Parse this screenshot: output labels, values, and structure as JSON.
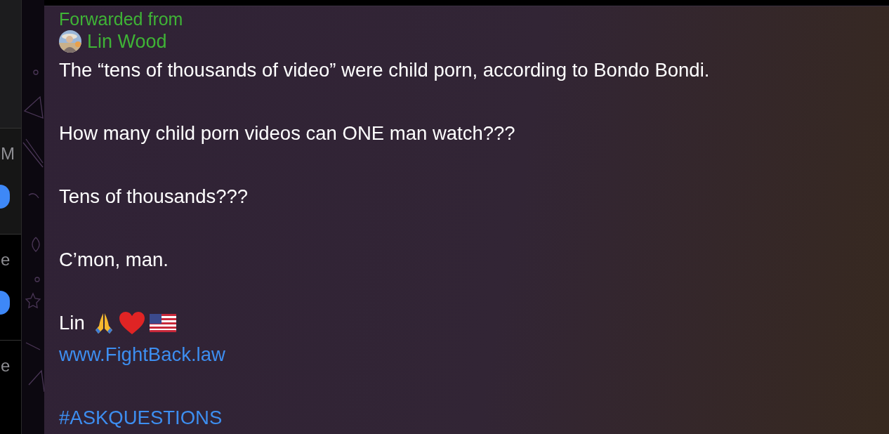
{
  "sidebar": {
    "items": [
      {
        "text": "M",
        "unread": true,
        "selected": true
      },
      {
        "text": "e",
        "unread": true,
        "selected": false
      },
      {
        "text": "e",
        "unread": false,
        "selected": false
      }
    ]
  },
  "message": {
    "forwarded_label": "Forwarded from",
    "author": "Lin Wood",
    "paragraphs": [
      "The “tens of thousands of video” were child porn, according to Bondo Bondi.",
      "How many child porn videos can ONE man watch???",
      "Tens of thousands???",
      "C’mon, man."
    ],
    "signature": "Lin",
    "link": "www.FightBack.law",
    "hashtag": "#ASKQUESTIONS"
  }
}
